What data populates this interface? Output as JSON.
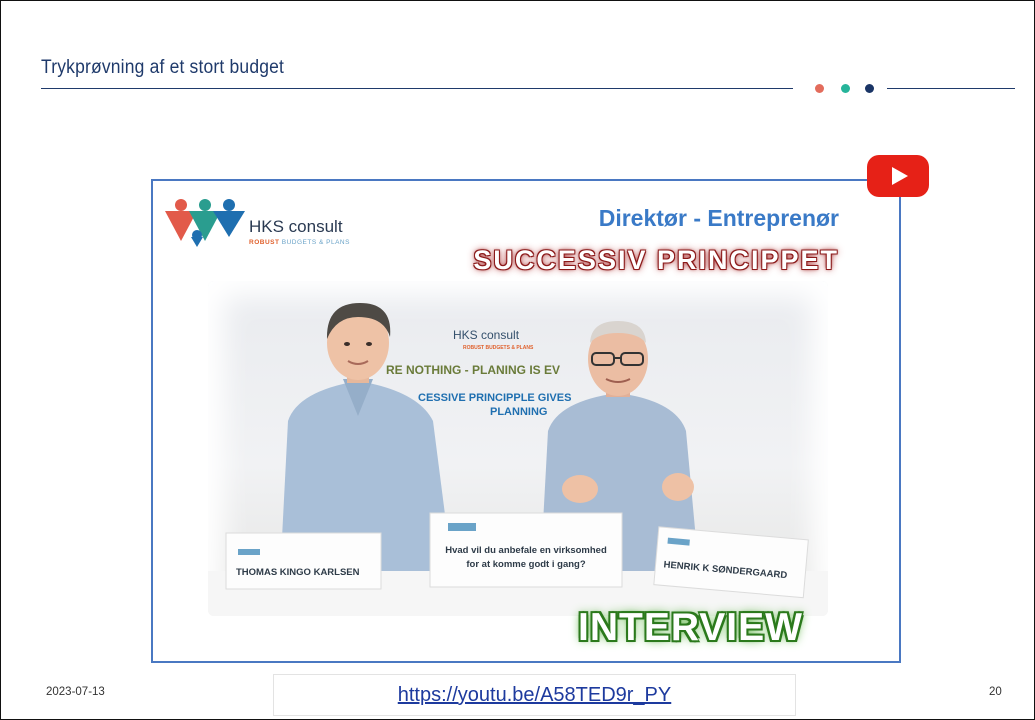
{
  "slide": {
    "title": "Trykprøvning af et stort budget",
    "date": "2023-07-13",
    "page_number": "20",
    "link": "https://youtu.be/A58TED9r_PY"
  },
  "video": {
    "logo_name": "HKS consult",
    "logo_tagline_bold": "ROBUST",
    "logo_tagline": " BUDGETS & PLANS",
    "role_heading": "Direktør - Entreprenør",
    "principle_heading": "SUCCESSIV PRINCIPPET",
    "interview_label": "INTERVIEW",
    "backdrop": {
      "brand": "HKS consult",
      "tagline": "ROBUST BUDGETS & PLANS",
      "line1": "PLANS ARE NOTHING - PLANING IS EVERYTHING",
      "line1_visible": "RE NOTHING - PLANING IS EV",
      "line2_visible": "CESSIVE PRINCIPPLE GIVES",
      "line3_visible": "PLANNING"
    },
    "name_cards": {
      "left": "THOMAS KINGO KARLSEN",
      "center_line1": "Hvad vil du anbefale en virksomhed",
      "center_line2": "for at komme godt i gang?",
      "right": "HENRIK K SØNDERGAARD"
    },
    "play_icon": "youtube-play-icon"
  },
  "colors": {
    "title": "#1f3a6b",
    "dot_coral": "#e36c5c",
    "dot_teal": "#26b49a",
    "dot_navy": "#1a3566",
    "frame": "#4a78c2",
    "youtube_red": "#e62117",
    "link": "#1d3a9e"
  }
}
